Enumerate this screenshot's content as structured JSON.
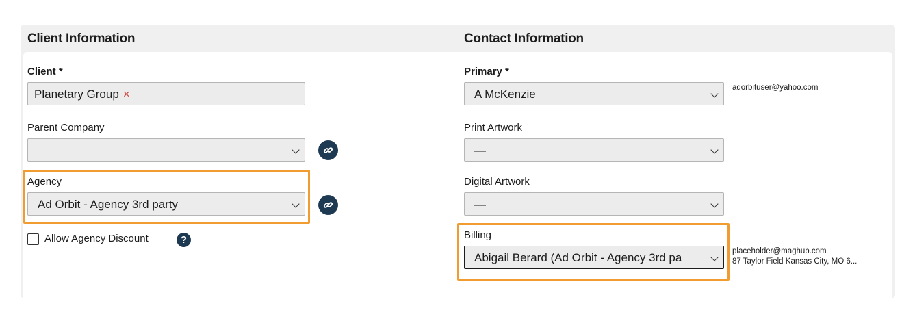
{
  "client_section": {
    "title": "Client Information",
    "client_label": "Client *",
    "client_value": "Planetary Group",
    "clear_symbol": "×",
    "parent_company_label": "Parent Company",
    "parent_company_value": "",
    "agency_label": "Agency",
    "agency_value": "Ad Orbit - Agency 3rd party",
    "allow_discount_label": "Allow Agency Discount",
    "allow_discount_checked": false,
    "help_symbol": "?"
  },
  "contact_section": {
    "title": "Contact Information",
    "primary_label": "Primary *",
    "primary_value": "A McKenzie",
    "primary_email": "adorbituser@yahoo.com",
    "print_artwork_label": "Print Artwork",
    "print_artwork_value": "—",
    "digital_artwork_label": "Digital Artwork",
    "digital_artwork_value": "—",
    "billing_label": "Billing",
    "billing_value": "Abigail Berard (Ad Orbit - Agency 3rd pa",
    "billing_email": "placeholder@maghub.com",
    "billing_address": "87 Taylor Field Kansas City, MO 6..."
  },
  "icons": {
    "link": "link-icon",
    "help": "help-icon",
    "chevron": "chevron-down-icon",
    "clear": "close-icon"
  },
  "colors": {
    "highlight": "#f09c31",
    "icon_bg": "#1e3a52",
    "clear_x": "#d0453d",
    "header_bg": "#f0f0f0"
  }
}
